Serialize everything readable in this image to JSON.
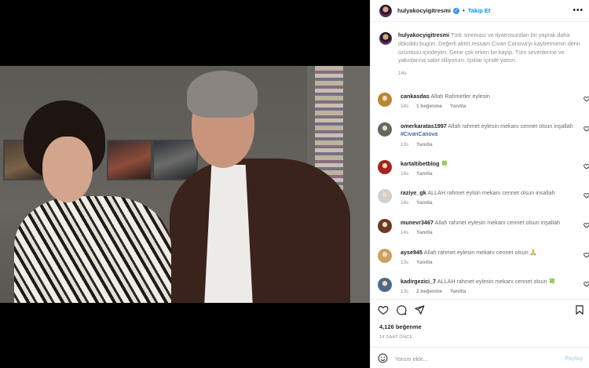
{
  "post": {
    "username": "hulyakocyigitresmi",
    "follow_label": "Takip Et",
    "separator": "•",
    "more_label": "•••",
    "verified_mark": "✓",
    "caption_text": "Türk sineması ve tiyatrosundan bir yaprak daha döküldü bugün. Değerli aktör,ressam Civan Canova'yı kaybetmenin derin üzüntüsü içindeyim. Gene çok erken bir kayıp. Tüm sevenlerine ve yakınlarına sabır diliyorum. Işıklar içinde yatsın.",
    "caption_time": "14s",
    "likes": "4,126 beğenme",
    "time_ago": "14 SAAT ÖNCE",
    "comment_placeholder": "Yorum ekle...",
    "post_button": "Paylaş"
  },
  "comments": [
    {
      "user": "cankasdas",
      "text": "Allah Rahmetler eylesin",
      "hashtag": "",
      "emoji": "",
      "time": "14s",
      "likes": "1 beğenme",
      "reply": "Yanıtla",
      "avatar_color": "#b8862e"
    },
    {
      "user": "omerkaratas1997",
      "text": "Allah rahmet eylesin mekanı cennet olsun inşallah",
      "hashtag": "#CivanCanova",
      "emoji": "",
      "time": "13s",
      "likes": "",
      "reply": "Yanıtla",
      "avatar_color": "#5f6b5e"
    },
    {
      "user": "kartaltibetblog",
      "text": "",
      "hashtag": "",
      "emoji": "🍀",
      "time": "14s",
      "likes": "",
      "reply": "Yanıtla",
      "avatar_color": "#a8231d"
    },
    {
      "user": "raziye_gk",
      "text": "ALLAH rahmet eylsin mekanı cennet olsun insallah",
      "hashtag": "",
      "emoji": "",
      "time": "14s",
      "likes": "",
      "reply": "Yanıtla",
      "avatar_color": "#cfcfcf"
    },
    {
      "user": "munevr3467",
      "text": "Allah rahmet eylesin mekanı cennet olsun inşallah",
      "hashtag": "",
      "emoji": "",
      "time": "14s",
      "likes": "",
      "reply": "Yanıtla",
      "avatar_color": "#6b3a22"
    },
    {
      "user": "ayse945",
      "text": "Allah rahmet eylesin mekanı cennet olsun",
      "hashtag": "",
      "emoji": "🙏",
      "time": "13s",
      "likes": "",
      "reply": "Yanıtla",
      "avatar_color": "#c9a25c"
    },
    {
      "user": "kadirgezici_7",
      "text": "ALLAH rahmet eylesin mekanı cennet olsun",
      "hashtag": "",
      "emoji": "🍀",
      "time": "13s",
      "likes": "2 beğenme",
      "reply": "Yanıtla",
      "avatar_color": "#4d6a86"
    }
  ],
  "icons": {
    "header_avatar": "profile-avatar",
    "heart": "heart-outline-icon",
    "comment": "comment-icon",
    "share": "paper-plane-icon",
    "save": "bookmark-icon",
    "emoji": "smiley-icon"
  },
  "colors": {
    "accent": "#0095f6",
    "verified": "#3897f0",
    "muted": "#8e8e8e",
    "post_disabled": "#b3dbff"
  }
}
